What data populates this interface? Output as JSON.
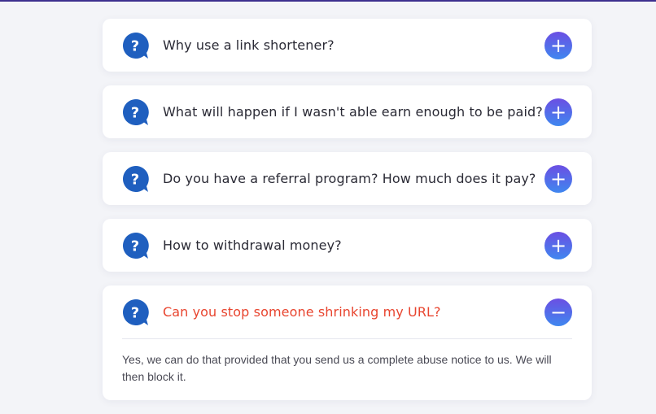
{
  "colors": {
    "accent_gradient_start": "#6b4fe3",
    "accent_gradient_end": "#3f87ef",
    "question_icon": "#1f5fbf",
    "open_question_text": "#e8452f"
  },
  "faq": {
    "items": [
      {
        "question": "Why use a link shortener?",
        "icon": "question-bubble-icon",
        "toggle": "+",
        "open": false
      },
      {
        "question": "What will happen if I wasn't able earn enough to be paid?",
        "icon": "question-bubble-icon",
        "toggle": "+",
        "open": false
      },
      {
        "question": "Do you have a referral program? How much does it pay?",
        "icon": "question-bubble-icon",
        "toggle": "+",
        "open": false
      },
      {
        "question": "How to withdrawal money?",
        "icon": "question-bubble-icon",
        "toggle": "+",
        "open": false
      },
      {
        "question": "Can you stop someone shrinking my URL?",
        "icon": "question-bubble-icon",
        "toggle": "−",
        "open": true,
        "answer": "Yes, we can do that provided that you send us a complete abuse notice to us. We will then block it."
      }
    ]
  }
}
